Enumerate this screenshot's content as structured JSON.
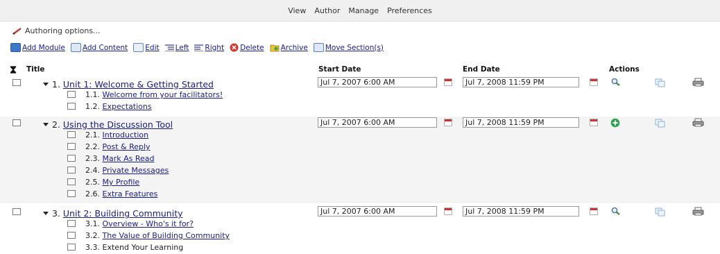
{
  "nav": {
    "items": [
      "View",
      "Author",
      "Manage",
      "Preferences"
    ]
  },
  "authoring": {
    "label": "Authoring options..."
  },
  "toolbar": {
    "add_module": "Add Module",
    "add_content": "Add Content",
    "edit": "Edit",
    "left": "Left",
    "right": "Right",
    "delete": "Delete",
    "archive": "Archive",
    "move": "Move Section(s)"
  },
  "table": {
    "headers": {
      "title": "Title",
      "start": "Start Date",
      "end": "End Date",
      "actions": "Actions"
    },
    "modules": [
      {
        "number": "1.",
        "title": "Unit 1: Welcome & Getting Started",
        "start": "Jul 7, 2007 6:00 AM",
        "end": "Jul 7, 2008 11:59 PM",
        "action_icon": "search-icon",
        "sections": [
          {
            "number": "1.1.",
            "title": "Welcome from your facilitators!",
            "link": true
          },
          {
            "number": "1.2.",
            "title": "Expectations",
            "link": true
          }
        ]
      },
      {
        "number": "2.",
        "title": "Using the Discussion Tool",
        "start": "Jul 7, 2007 6:00 AM",
        "end": "Jul 7, 2008 11:59 PM",
        "action_icon": "add-icon",
        "sections": [
          {
            "number": "2.1.",
            "title": "Introduction",
            "link": true
          },
          {
            "number": "2.2.",
            "title": "Post & Reply",
            "link": true
          },
          {
            "number": "2.3.",
            "title": "Mark As Read",
            "link": true
          },
          {
            "number": "2.4.",
            "title": "Private Messages",
            "link": true
          },
          {
            "number": "2.5.",
            "title": "My Profile",
            "link": true
          },
          {
            "number": "2.6.",
            "title": "Extra Features",
            "link": true
          }
        ]
      },
      {
        "number": "3.",
        "title": "Unit 2: Building Community",
        "start": "Jul 7, 2007 6:00 AM",
        "end": "Jul 7, 2008 11:59 PM",
        "action_icon": "search-icon",
        "sections": [
          {
            "number": "3.1.",
            "title": "Overview - Who's it for?",
            "link": true
          },
          {
            "number": "3.2.",
            "title": "The Value of Building Community",
            "link": true
          },
          {
            "number": "3.3.",
            "title": "Extend Your Learning",
            "link": false
          }
        ]
      }
    ]
  },
  "colors": {
    "link": "#1a1a8a",
    "row_shade": "#f4f4f4",
    "add_green": "#2ea44f",
    "delete_red": "#d9352b"
  }
}
